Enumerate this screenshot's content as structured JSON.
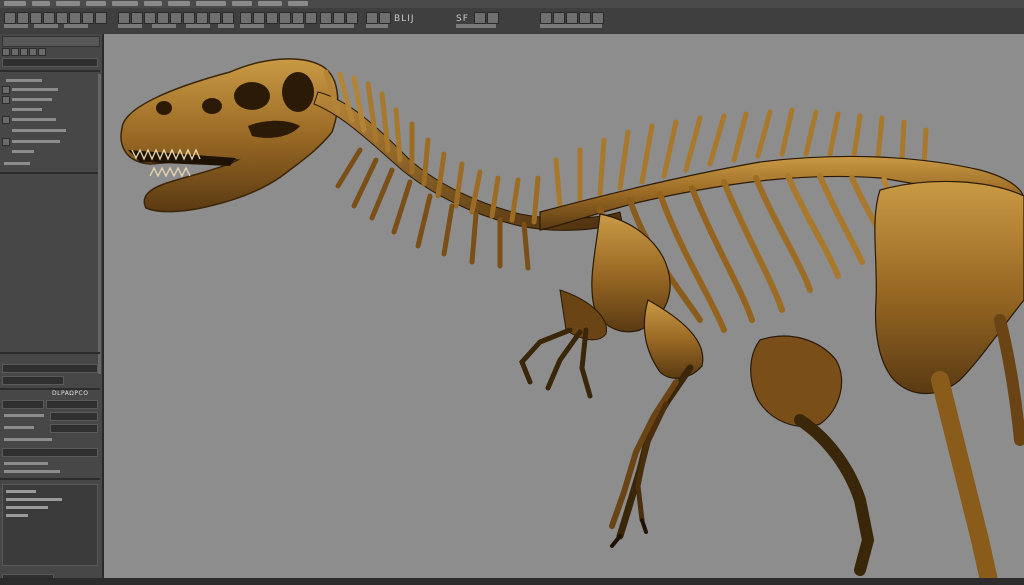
{
  "app": {
    "accent": "#b08433",
    "viewport_bg": "#8d8d8d",
    "panel_bg": "#474747"
  },
  "toolbar": {
    "text_1": "BLIJ",
    "text_2": "SF"
  },
  "left_panel": {
    "lower_title": "DLPAΩPCO"
  },
  "viewport": {
    "model_icon": "dinosaur-skeleton",
    "model_color": "#a7772c"
  }
}
